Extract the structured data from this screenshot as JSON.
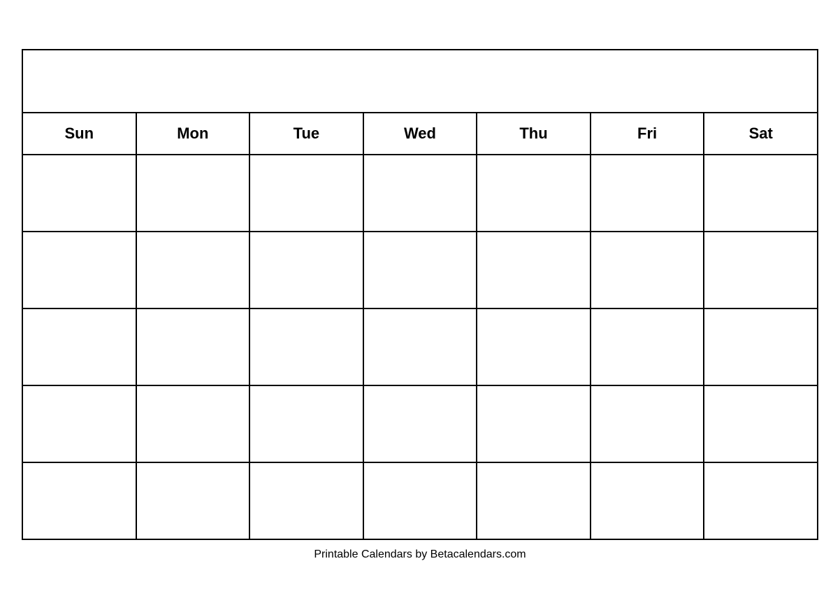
{
  "calendar": {
    "title": "",
    "days_of_week": [
      "Sun",
      "Mon",
      "Tue",
      "Wed",
      "Thu",
      "Fri",
      "Sat"
    ],
    "weeks": [
      [
        "",
        "",
        "",
        "",
        "",
        "",
        ""
      ],
      [
        "",
        "",
        "",
        "",
        "",
        "",
        ""
      ],
      [
        "",
        "",
        "",
        "",
        "",
        "",
        ""
      ],
      [
        "",
        "",
        "",
        "",
        "",
        "",
        ""
      ],
      [
        "",
        "",
        "",
        "",
        "",
        "",
        ""
      ]
    ]
  },
  "footer": {
    "text": "Printable Calendars by Betacalendars.com"
  }
}
